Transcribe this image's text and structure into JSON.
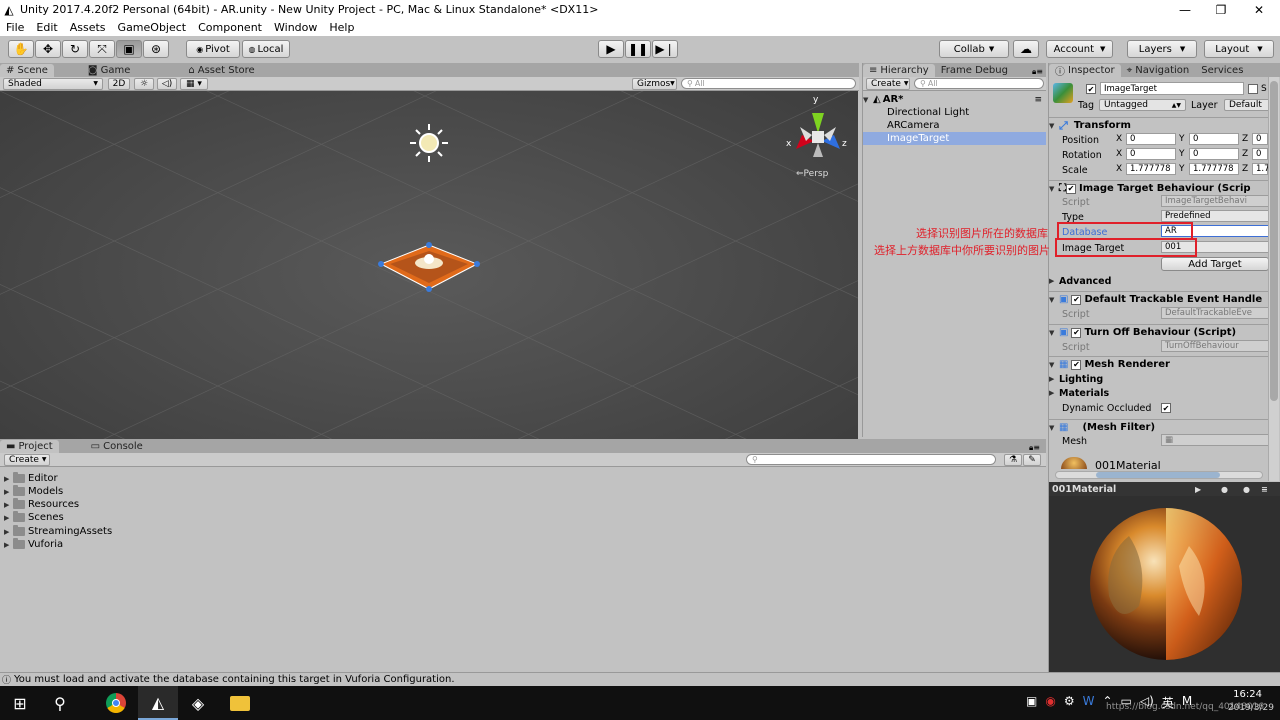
{
  "window": {
    "title": "Unity 2017.4.20f2 Personal (64bit) - AR.unity - New Unity Project - PC, Mac & Linux Standalone* <DX11>"
  },
  "menu": [
    "File",
    "Edit",
    "Assets",
    "GameObject",
    "Component",
    "Window",
    "Help"
  ],
  "toolbar": {
    "pivot": "Pivot",
    "local": "Local",
    "collab": "Collab",
    "account": "Account",
    "layers": "Layers",
    "layout": "Layout"
  },
  "scene": {
    "tabs": [
      "Scene",
      "Game",
      "Asset Store"
    ],
    "shading": "Shaded",
    "mode_2d": "2D",
    "gizmos": "Gizmos",
    "search_placeholder": "All",
    "persp": "Persp",
    "axis_y": "y",
    "axis_x": "x",
    "axis_z": "z"
  },
  "hierarchy": {
    "tabs": [
      "Hierarchy",
      "Frame Debug"
    ],
    "create": "Create",
    "search_placeholder": "All",
    "root": "AR*",
    "items": [
      "Directional Light",
      "ARCamera",
      "ImageTarget"
    ]
  },
  "inspector": {
    "tabs": [
      "Inspector",
      "Navigation",
      "Services"
    ],
    "object_name": "ImageTarget",
    "static_label": "S",
    "tag_label": "Tag",
    "tag_value": "Untagged",
    "layer_label": "Layer",
    "layer_value": "Default",
    "transform": {
      "title": "Transform",
      "position_label": "Position",
      "rotation_label": "Rotation",
      "scale_label": "Scale",
      "position": [
        "0",
        "0",
        "0"
      ],
      "rotation": [
        "0",
        "0",
        "0"
      ],
      "scale": [
        "1.777778",
        "1.777778",
        "1.7"
      ]
    },
    "itb": {
      "title": "Image Target Behaviour (Scrip",
      "script_label": "Script",
      "script_value": "ImageTargetBehavi",
      "type_label": "Type",
      "type_value": "Predefined",
      "database_label": "Database",
      "database_value": "AR",
      "image_target_label": "Image Target",
      "image_target_value": "001",
      "add_target": "Add Target",
      "advanced": "Advanced"
    },
    "annotations": {
      "line1": "选择识别图片所在的数据库",
      "line2": "选择上方数据库中你所要识别的图片"
    },
    "dteh": {
      "title": "Default Trackable Event Handle",
      "script_label": "Script",
      "script_value": "DefaultTrackableEve"
    },
    "tob": {
      "title": "Turn Off Behaviour (Script)",
      "script_label": "Script",
      "script_value": "TurnOffBehaviour"
    },
    "mesh_renderer": {
      "title": "Mesh Renderer",
      "lighting": "Lighting",
      "materials": "Materials",
      "dynamic_occluded": "Dynamic Occluded"
    },
    "mesh_filter": {
      "title": "(Mesh Filter)",
      "mesh_label": "Mesh"
    },
    "material_name": "001Material",
    "preview_title": "001Material"
  },
  "project": {
    "tabs": [
      "Project",
      "Console"
    ],
    "create": "Create",
    "folders": [
      "Editor",
      "Models",
      "Resources",
      "Scenes",
      "StreamingAssets",
      "Vuforia"
    ]
  },
  "status": {
    "message": "You must load and activate the database containing this target in Vuforia Configuration."
  },
  "taskbar": {
    "time": "16:24",
    "date": "2019/3/29",
    "watermark": "https://blog.csdn.net/qq_40148016"
  },
  "colors": {
    "highlight_box": "#e0202a",
    "annotation_text": "#e0202a",
    "selection": "#3d6fd6"
  }
}
